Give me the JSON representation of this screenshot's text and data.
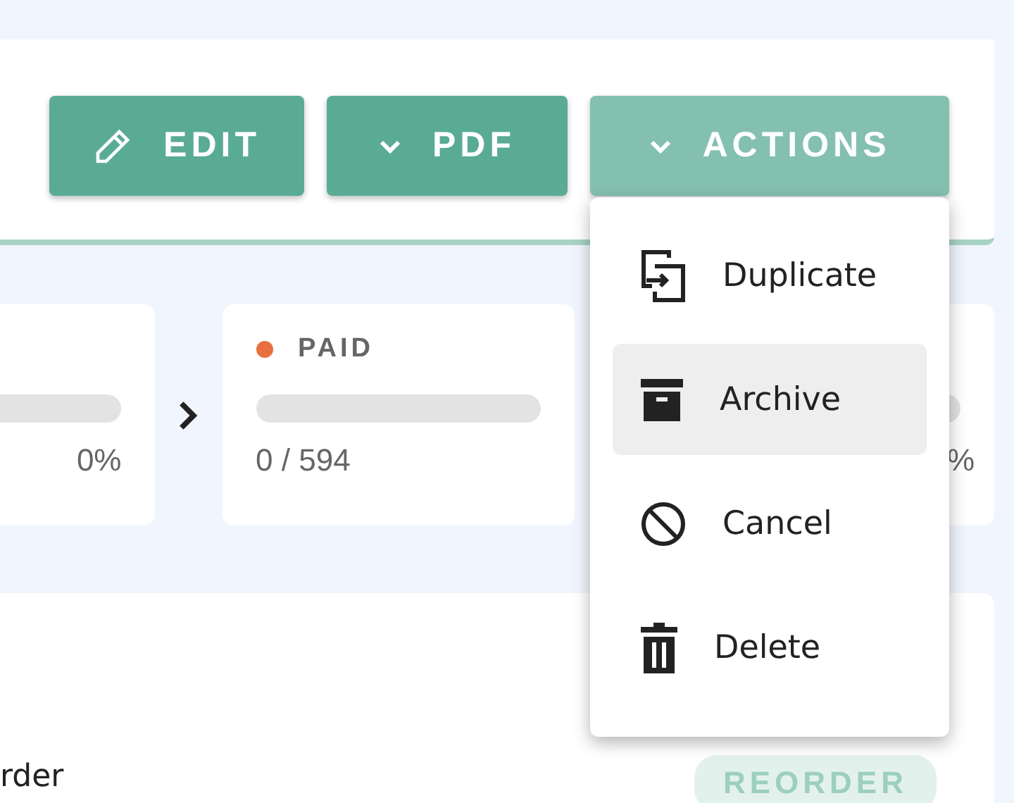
{
  "toolbar": {
    "buttons": [
      {
        "label": "EDIT",
        "kind": "edit",
        "open": false
      },
      {
        "label": "PDF",
        "kind": "dropdown",
        "open": false
      },
      {
        "label": "ACTIONS",
        "kind": "dropdown",
        "open": true
      }
    ]
  },
  "stages": [
    {
      "percent": "0%",
      "level": 0
    },
    {
      "title": "PAID",
      "color": "#e8703f",
      "count": "0 / 594",
      "level": 0
    },
    {
      "percent": "%",
      "level": 0
    }
  ],
  "actions_menu": {
    "items": [
      {
        "label": "Duplicate",
        "kind": "duplicate",
        "selected": false
      },
      {
        "label": "Archive",
        "kind": "archive",
        "selected": true
      },
      {
        "label": "Cancel",
        "kind": "cancel",
        "selected": false
      },
      {
        "label": "Delete",
        "kind": "delete",
        "selected": false
      }
    ]
  },
  "order": {
    "label": "rder",
    "badge": "REORDER"
  }
}
